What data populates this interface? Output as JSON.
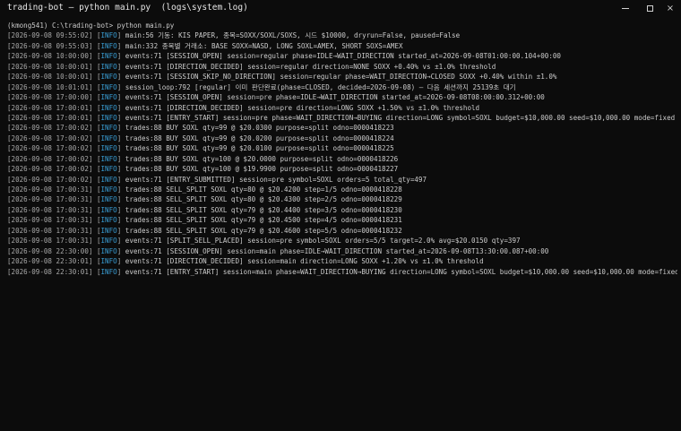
{
  "window": {
    "title": "trading-bot — python main.py  (logs\\system.log)",
    "controls": {
      "minimize": "minimize",
      "maximize": "maximize",
      "close": "×"
    }
  },
  "prompt": {
    "text": "(kmong541) C:\\trading-bot> python main.py"
  },
  "logs": [
    {
      "ts": "[2026-09-08 09:55:02]",
      "level": "INFO",
      "msg": "main:56 기동: KIS PAPER, 종목=SOXX/SOXL/SOXS, 시드 $10000, dryrun=False, paused=False"
    },
    {
      "ts": "[2026-09-08 09:55:03]",
      "level": "INFO",
      "msg": "main:332 종목별 거래소: BASE SOXX=NASD, LONG SOXL=AMEX, SHORT SOXS=AMEX"
    },
    {
      "ts": "[2026-09-08 10:00:00]",
      "level": "INFO",
      "msg": "events:71 [SESSION_OPEN] session=regular phase=IDLE→WAIT_DIRECTION started_at=2026-09-08T01:00:00.104+00:00"
    },
    {
      "ts": "[2026-09-08 10:00:01]",
      "level": "INFO",
      "msg": "events:71 [DIRECTION_DECIDED] session=regular direction=NONE SOXX +0.40% vs ±1.0% threshold"
    },
    {
      "ts": "[2026-09-08 10:00:01]",
      "level": "INFO",
      "msg": "events:71 [SESSION_SKIP_NO_DIRECTION] session=regular phase=WAIT_DIRECTION→CLOSED SOXX +0.40% within ±1.0%"
    },
    {
      "ts": "[2026-09-08 10:01:01]",
      "level": "INFO",
      "msg": "session_loop:792 [regular] 이미 판단완료(phase=CLOSED, decided=2026-09-08) — 다음 세션까지 25139초 대기"
    },
    {
      "ts": "[2026-09-08 17:00:00]",
      "level": "INFO",
      "msg": "events:71 [SESSION_OPEN] session=pre phase=IDLE→WAIT_DIRECTION started_at=2026-09-08T08:00:00.312+00:00"
    },
    {
      "ts": "[2026-09-08 17:00:01]",
      "level": "INFO",
      "msg": "events:71 [DIRECTION_DECIDED] session=pre direction=LONG SOXX +1.50% vs ±1.0% threshold"
    },
    {
      "ts": "[2026-09-08 17:00:01]",
      "level": "INFO",
      "msg": "events:71 [ENTRY_START] session=pre phase=WAIT_DIRECTION→BUYING direction=LONG symbol=SOXL budget=$10,000.00 seed=$10,000.00 mode=fixed"
    },
    {
      "ts": "[2026-09-08 17:00:02]",
      "level": "INFO",
      "msg": "trades:88 BUY SOXL qty=99 @ $20.0300 purpose=split odno=0000418223"
    },
    {
      "ts": "[2026-09-08 17:00:02]",
      "level": "INFO",
      "msg": "trades:88 BUY SOXL qty=99 @ $20.0200 purpose=split odno=0000418224"
    },
    {
      "ts": "[2026-09-08 17:00:02]",
      "level": "INFO",
      "msg": "trades:88 BUY SOXL qty=99 @ $20.0100 purpose=split odno=0000418225"
    },
    {
      "ts": "[2026-09-08 17:00:02]",
      "level": "INFO",
      "msg": "trades:88 BUY SOXL qty=100 @ $20.0000 purpose=split odno=0000418226"
    },
    {
      "ts": "[2026-09-08 17:00:02]",
      "level": "INFO",
      "msg": "trades:88 BUY SOXL qty=100 @ $19.9900 purpose=split odno=0000418227"
    },
    {
      "ts": "[2026-09-08 17:00:02]",
      "level": "INFO",
      "msg": "events:71 [ENTRY_SUBMITTED] session=pre symbol=SOXL orders=5 total_qty=497"
    },
    {
      "ts": "[2026-09-08 17:00:31]",
      "level": "INFO",
      "msg": "trades:88 SELL_SPLIT SOXL qty=80 @ $20.4200 step=1/5 odno=0000418228"
    },
    {
      "ts": "[2026-09-08 17:00:31]",
      "level": "INFO",
      "msg": "trades:88 SELL_SPLIT SOXL qty=80 @ $20.4300 step=2/5 odno=0000418229"
    },
    {
      "ts": "[2026-09-08 17:00:31]",
      "level": "INFO",
      "msg": "trades:88 SELL_SPLIT SOXL qty=79 @ $20.4400 step=3/5 odno=0000418230"
    },
    {
      "ts": "[2026-09-08 17:00:31]",
      "level": "INFO",
      "msg": "trades:88 SELL_SPLIT SOXL qty=79 @ $20.4500 step=4/5 odno=0000418231"
    },
    {
      "ts": "[2026-09-08 17:00:31]",
      "level": "INFO",
      "msg": "trades:88 SELL_SPLIT SOXL qty=79 @ $20.4600 step=5/5 odno=0000418232"
    },
    {
      "ts": "[2026-09-08 17:00:31]",
      "level": "INFO",
      "msg": "events:71 [SPLIT_SELL_PLACED] session=pre symbol=SOXL orders=5/5 target=2.0% avg=$20.0150 qty=397"
    },
    {
      "ts": "[2026-09-08 22:30:00]",
      "level": "INFO",
      "msg": "events:71 [SESSION_OPEN] session=main phase=IDLE→WAIT_DIRECTION started_at=2026-09-08T13:30:00.087+00:00"
    },
    {
      "ts": "[2026-09-08 22:30:01]",
      "level": "INFO",
      "msg": "events:71 [DIRECTION_DECIDED] session=main direction=LONG SOXX +1.20% vs ±1.0% threshold"
    },
    {
      "ts": "[2026-09-08 22:30:01]",
      "level": "INFO",
      "msg": "events:71 [ENTRY_START] session=main phase=WAIT_DIRECTION→BUYING direction=LONG symbol=SOXL budget=$10,000.00 seed=$10,000.00 mode=fixed"
    }
  ],
  "colors": {
    "background": "#0c0c0c",
    "text": "#cccccc",
    "timestamp": "#a9a9a9",
    "info_level": "#3aa0d8"
  }
}
